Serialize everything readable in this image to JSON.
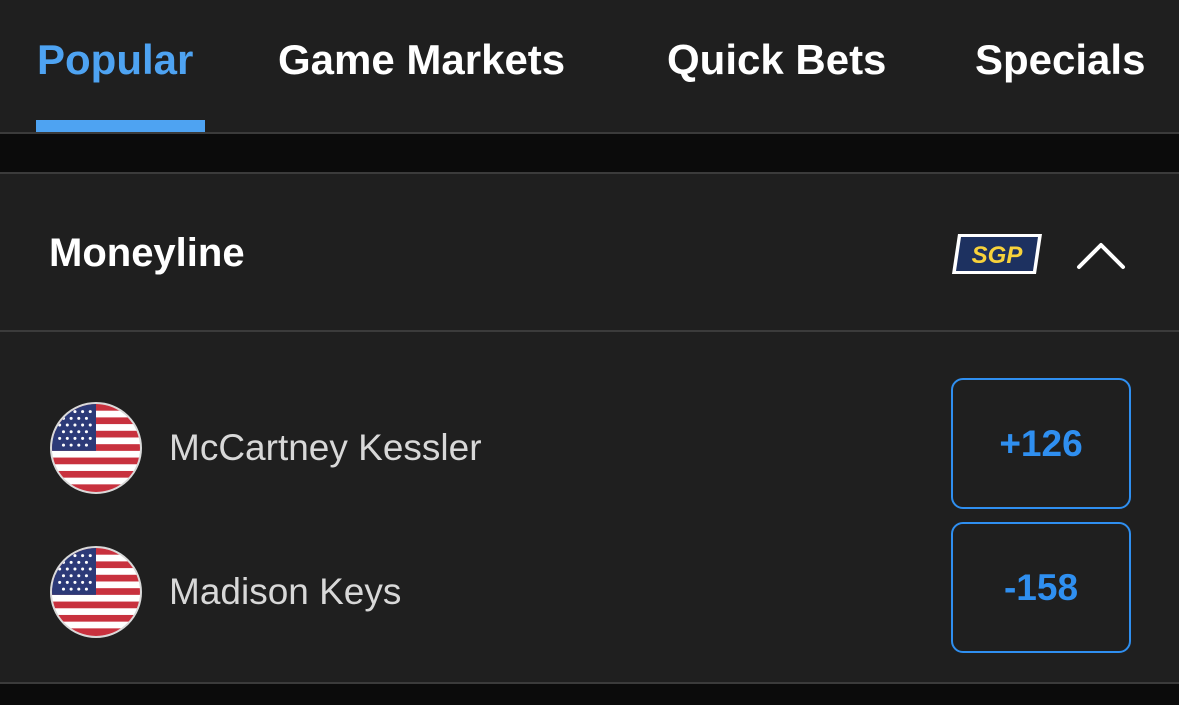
{
  "tabs": [
    {
      "label": "Popular",
      "active": true
    },
    {
      "label": "Game Markets",
      "active": false
    },
    {
      "label": "Quick Bets",
      "active": false
    },
    {
      "label": "Specials",
      "active": false
    }
  ],
  "market": {
    "title": "Moneyline",
    "badge": "SGP",
    "collapse_icon": "chevron-up-icon",
    "selections": [
      {
        "player": "McCartney Kessler",
        "flag_icon": "us-flag-icon",
        "odds": "+126"
      },
      {
        "player": "Madison Keys",
        "flag_icon": "us-flag-icon",
        "odds": "-158"
      }
    ]
  },
  "colors": {
    "accent": "#4ea3f2",
    "odds": "#2f8ff0",
    "panel": "#1f1f1f",
    "background": "#0b0b0b",
    "badge_bg": "#1d3160",
    "badge_text": "#f7d23b"
  }
}
